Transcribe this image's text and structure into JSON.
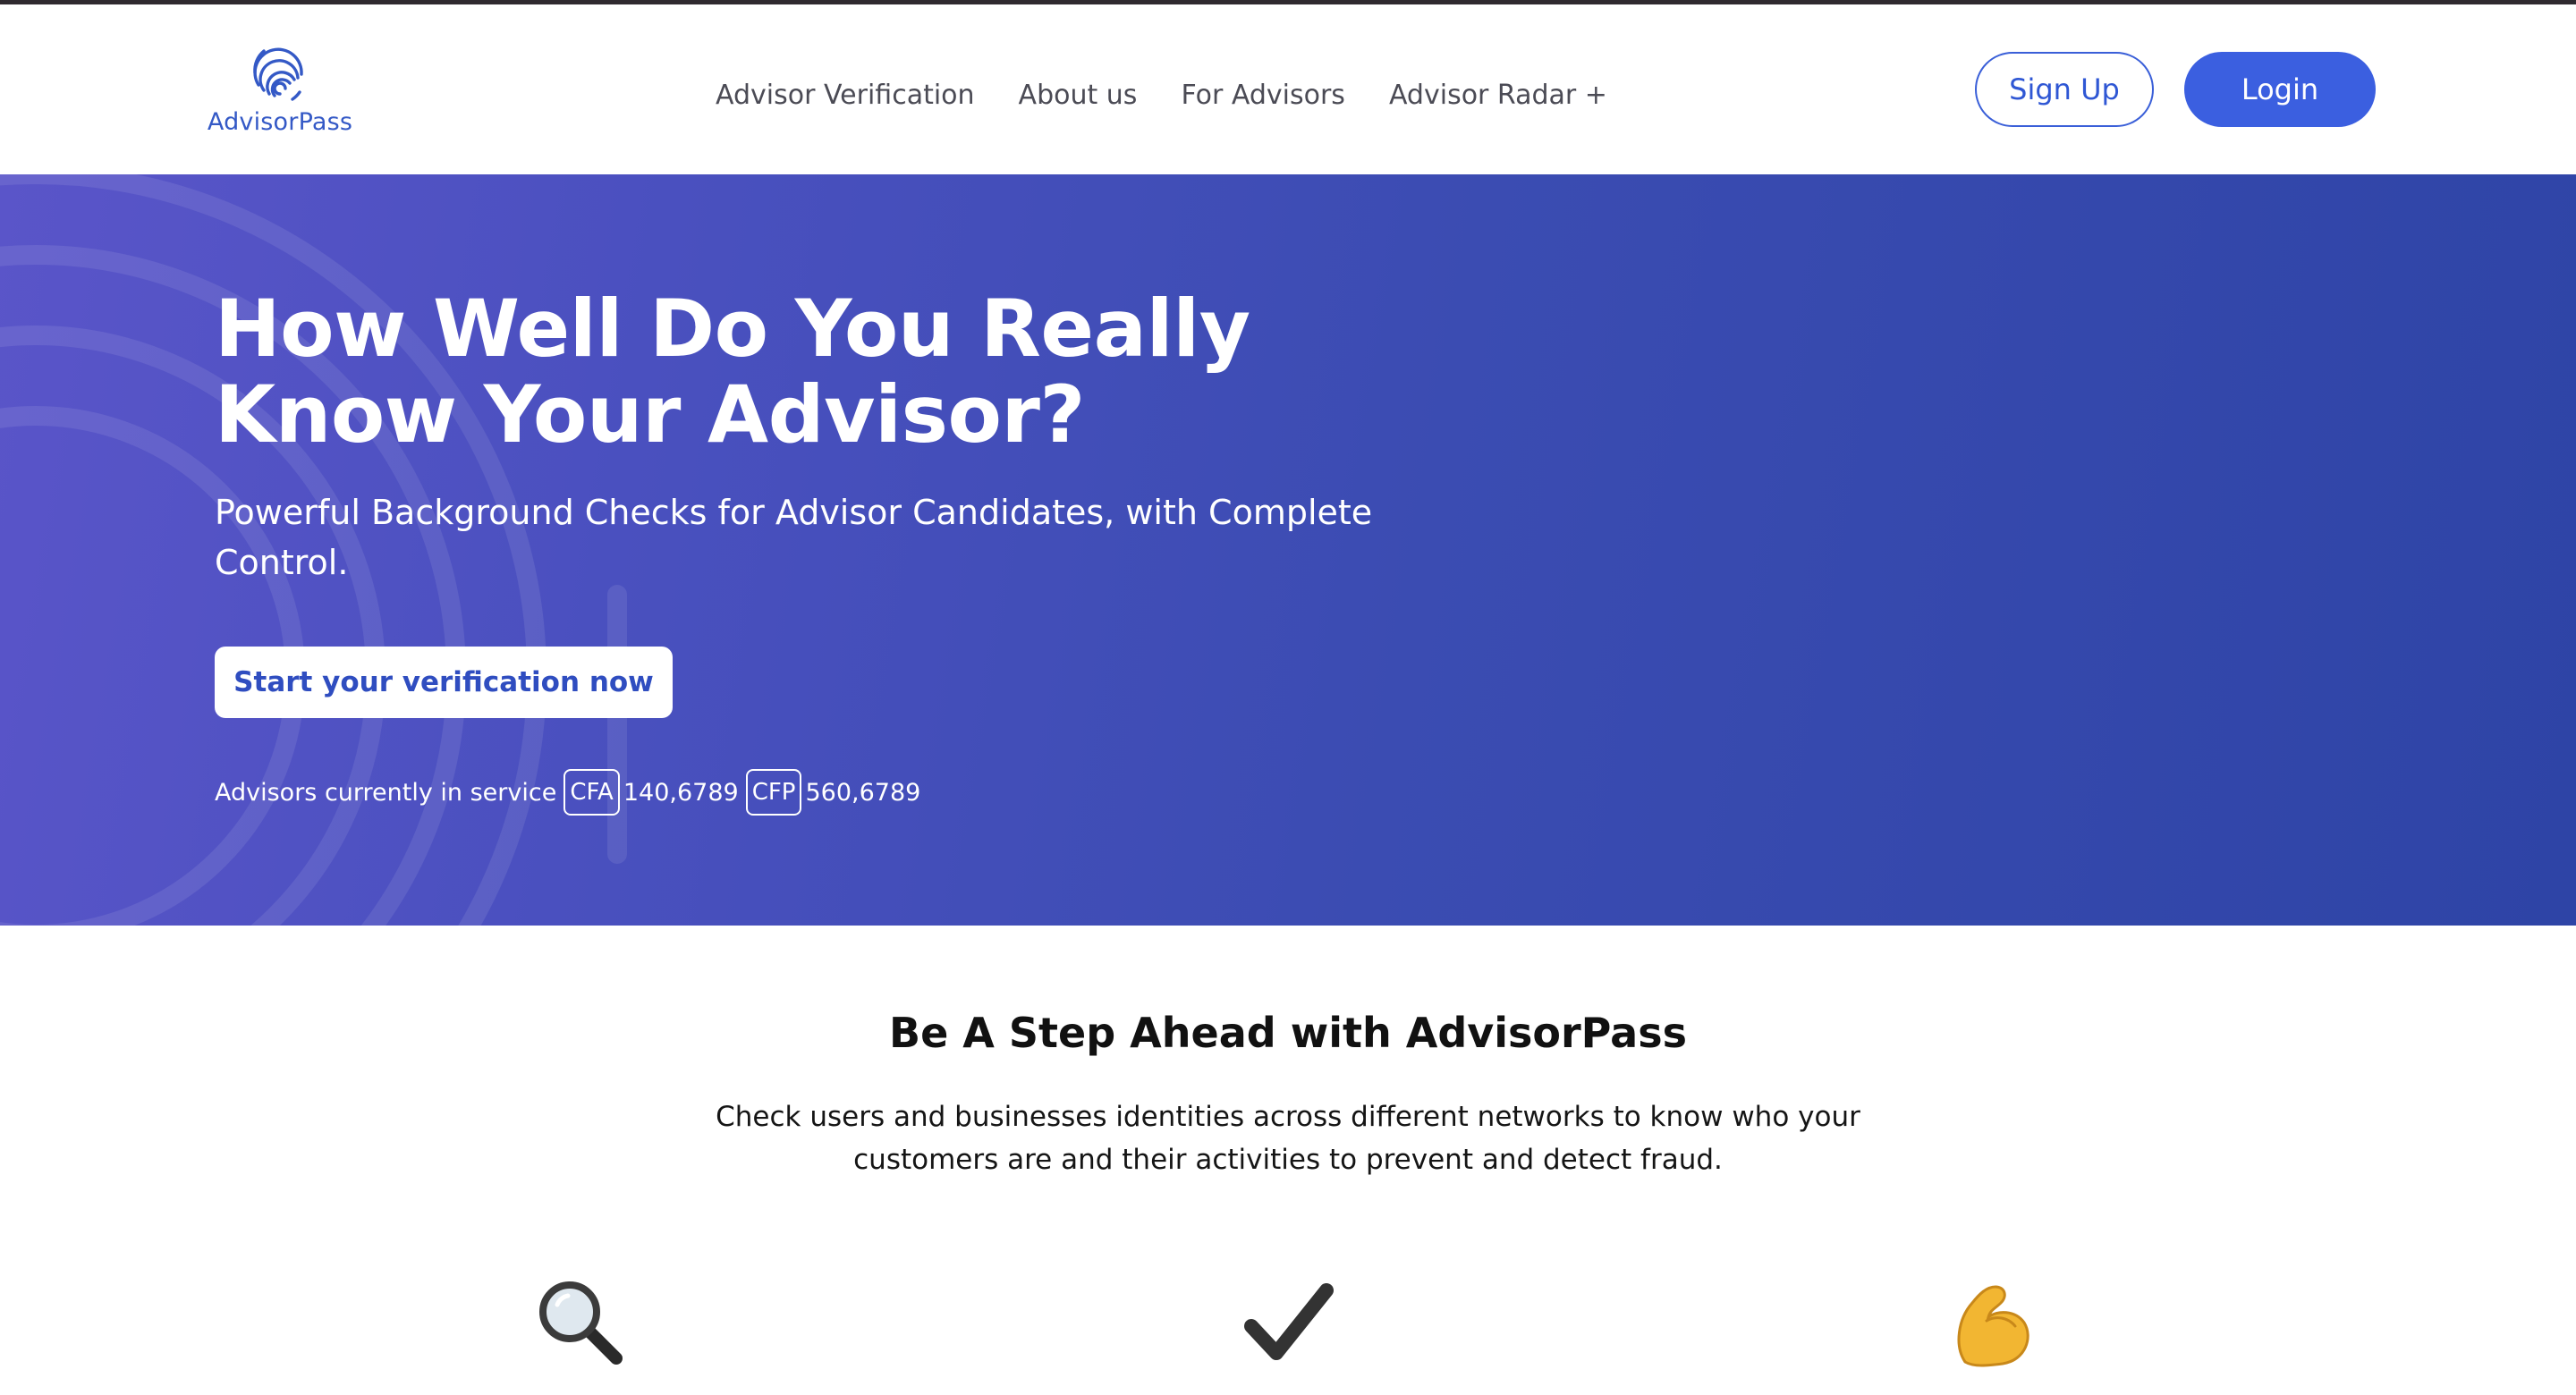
{
  "brand": {
    "name": "AdvisorPass",
    "color": "#3459c6",
    "logo_icon": "fingerprint-icon"
  },
  "nav": {
    "items": [
      {
        "label": "Advisor Verification"
      },
      {
        "label": "About us"
      },
      {
        "label": "For Advisors"
      },
      {
        "label": "Advisor Radar +"
      }
    ]
  },
  "auth": {
    "signup_label": "Sign Up",
    "login_label": "Login"
  },
  "hero": {
    "title": "How Well Do You Really Know Your Advisor?",
    "subtitle": "Powerful Background Checks for Advisor Candidates, with Complete Control.",
    "cta_label": "Start your verification now",
    "stats": {
      "label": "Advisors currently in service",
      "items": [
        {
          "badge": "CFA",
          "value": "140,6789"
        },
        {
          "badge": "CFP",
          "value": "560,6789"
        }
      ]
    }
  },
  "section": {
    "title": "Be A Step Ahead with AdvisorPass",
    "description": "Check users and businesses identities across different networks to know who your customers are and their activities to prevent and detect fraud."
  },
  "features": [
    {
      "icon": "magnifying-glass-icon"
    },
    {
      "icon": "checkmark-icon"
    },
    {
      "icon": "flexed-biceps-icon"
    }
  ],
  "colors": {
    "accent": "#3b5fe0",
    "hero_gradient_start": "#5a55c9",
    "hero_gradient_end": "#2e44a6"
  }
}
